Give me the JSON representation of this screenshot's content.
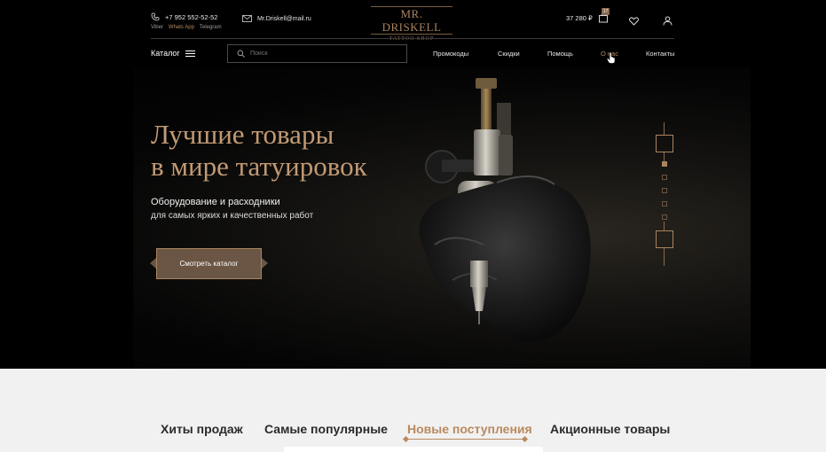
{
  "header": {
    "phone": "+7 952 552-52-52",
    "messengers": [
      "Viber",
      "Whats App",
      "Telegram"
    ],
    "email": "Mr.Driskell@mail.ru",
    "logo_main": "MR. DRISKELL",
    "logo_sub": "TATTOO SHOP",
    "cart_total": "37 280 ₽",
    "cart_count": "17",
    "catalog_label": "Каталог",
    "search_placeholder": "Поиск",
    "nav": {
      "promo": "Промокоды",
      "sale": "Скидки",
      "help": "Помощь",
      "about": "О нас",
      "contacts": "Контакты"
    }
  },
  "hero": {
    "title_line1": "Лучшие товары",
    "title_line2": "в мире татуировок",
    "subtitle_line1": "Оборудование и расходники",
    "subtitle_line2": "для самых ярких и качественных работ",
    "cta_label": "Смотреть каталог",
    "slides_total": 5,
    "slide_active": 1
  },
  "tabs": [
    {
      "label": "Хиты продаж",
      "active": false
    },
    {
      "label": "Самые популярные",
      "active": false
    },
    {
      "label": "Новые поступления",
      "active": true
    },
    {
      "label": "Акционные товары",
      "active": false
    }
  ],
  "colors": {
    "accent": "#b98a5e",
    "background": "#000000",
    "bottom_bg": "#f1f1f1"
  }
}
